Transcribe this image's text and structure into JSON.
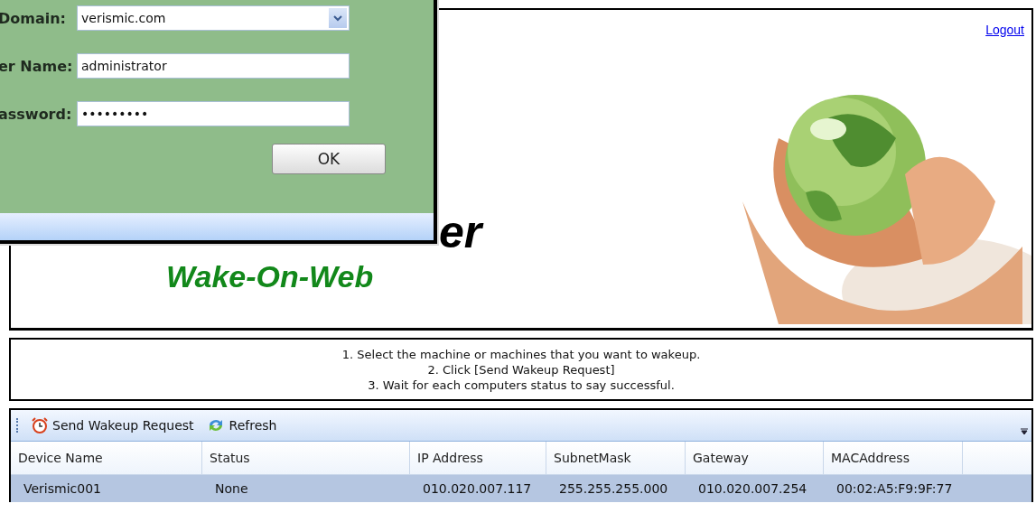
{
  "login_dialog": {
    "fields": [
      {
        "kind": "select",
        "label": "Domain:",
        "value": "verismic.com"
      },
      {
        "kind": "text",
        "label": "er Name:",
        "value": "administrator"
      },
      {
        "kind": "password",
        "label": "assword:",
        "value": "•••••••••"
      }
    ],
    "ok_button": "OK"
  },
  "header": {
    "logout_link": "Logout",
    "title_fragment": "er",
    "subtitle": "Wake-On-Web"
  },
  "instructions": [
    "1. Select the machine or machines that you want to wakeup.",
    "2. Click [Send Wakeup Request]",
    "3. Wait for each computers status to say successful."
  ],
  "toolbar": {
    "buttons": [
      {
        "kind": "alarm",
        "label": "Send Wakeup Request"
      },
      {
        "kind": "refresh",
        "label": "Refresh"
      }
    ]
  },
  "table": {
    "columns": [
      "Device Name",
      "Status",
      "IP Address",
      "SubnetMask",
      "Gateway",
      "MACAddress"
    ],
    "rows": [
      {
        "selected": true,
        "cells": [
          "Verismic001",
          "None",
          "010.020.007.117",
          "255.255.255.000",
          "010.020.007.254",
          "00:02:A5:F9:9F:77"
        ]
      }
    ]
  }
}
